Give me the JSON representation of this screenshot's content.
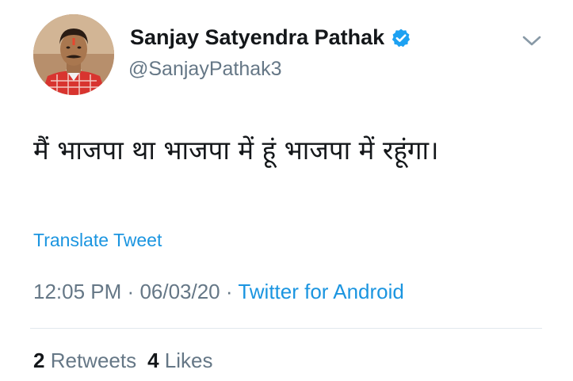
{
  "user": {
    "display_name": "Sanjay Satyendra Pathak",
    "handle": "@SanjayPathak3",
    "verified": true
  },
  "tweet": {
    "text": "मैं भाजपा था भाजपा में हूं भाजपा में रहूंगा।",
    "translate_label": "Translate Tweet",
    "time": "12:05 PM",
    "separator": "·",
    "date": "06/03/20",
    "source": "Twitter for Android"
  },
  "stats": {
    "retweets_count": "2",
    "retweets_label": "Retweets",
    "likes_count": "4",
    "likes_label": "Likes"
  },
  "icons": {
    "verified": "verified-badge-icon",
    "menu": "chevron-down-icon"
  },
  "colors": {
    "link": "#1b95e0",
    "secondary_text": "#657786",
    "primary_text": "#14171a",
    "divider": "#e1e8ed"
  }
}
